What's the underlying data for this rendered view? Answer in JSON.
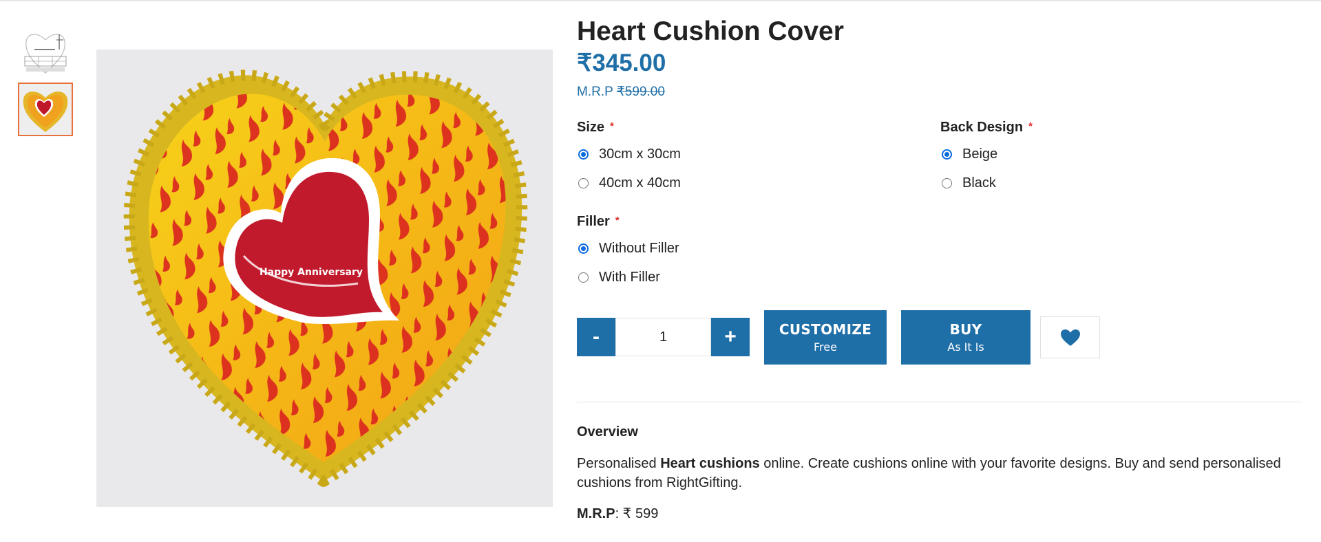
{
  "product": {
    "title": "Heart Cushion Cover",
    "price": "₹345.00",
    "mrp_prefix": "M.R.P ",
    "mrp_value": "₹599.00",
    "image_text": "Happy Anniversary"
  },
  "options": {
    "size": {
      "label": "Size",
      "required_mark": "*",
      "choices": [
        "30cm x 30cm",
        "40cm x 40cm"
      ],
      "selected": "30cm x 30cm"
    },
    "back_design": {
      "label": "Back Design",
      "required_mark": "*",
      "choices": [
        "Beige",
        "Black"
      ],
      "selected": "Beige"
    },
    "filler": {
      "label": "Filler",
      "required_mark": "*",
      "choices": [
        "Without Filler",
        "With Filler"
      ],
      "selected": "Without Filler"
    }
  },
  "quantity": {
    "minus_label": "-",
    "value": "1",
    "plus_label": "+"
  },
  "buttons": {
    "customize_main": "CUSTOMIZE",
    "customize_sub": "Free",
    "buy_main": "BUY",
    "buy_sub": "As It Is"
  },
  "icons": {
    "wishlist": "heart-icon"
  },
  "overview": {
    "title": "Overview",
    "text_before": "Personalised ",
    "text_bold": "Heart cushions",
    "text_after": " online. Create cushions online with your favorite designs. Buy and send personalised cushions from RightGifting.",
    "mrp_label": "M.R.P",
    "mrp_value": ": ₹ 599"
  },
  "colors": {
    "accent_blue": "#1e6ea7",
    "required_red": "#e02b27",
    "thumb_active_border": "#e8703a",
    "radio_blue": "#0a6bde"
  }
}
